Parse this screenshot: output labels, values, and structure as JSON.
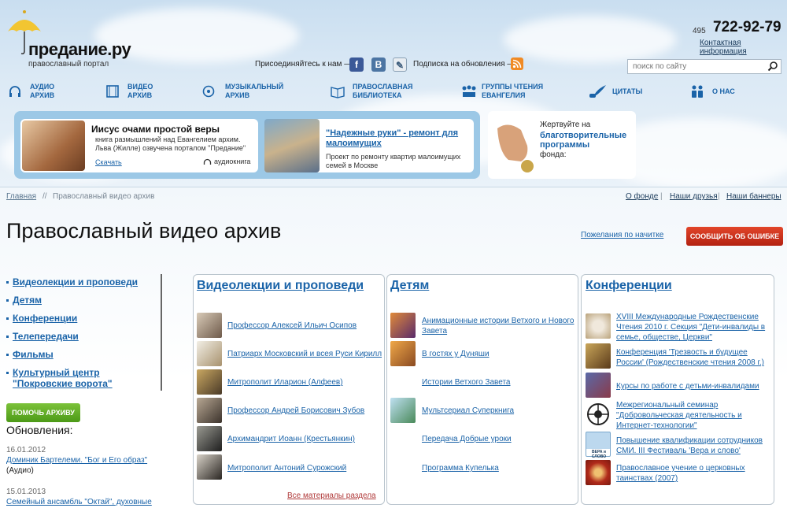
{
  "header": {
    "logo_text": "преданиe.ру",
    "logo_sub": "православный портал",
    "phone_code": "495",
    "phone_number": "722-92-79",
    "contact_link": "Контактная информация",
    "join_label": "Присоединяйтесь к нам —",
    "subscribe_label": "Подписка на обновления —",
    "search_placeholder": "поиск по сайту"
  },
  "nav": [
    {
      "line1": "Аудио",
      "line2": "архив"
    },
    {
      "line1": "Видео",
      "line2": "архив"
    },
    {
      "line1": "Музыкальный",
      "line2": "архив"
    },
    {
      "line1": "Православная",
      "line2": "библиотека"
    },
    {
      "line1": "Группы чтения",
      "line2": "Евангелия"
    },
    {
      "line1": "Цитаты",
      "line2": ""
    },
    {
      "line1": "О нас",
      "line2": ""
    }
  ],
  "banners": {
    "b1": {
      "title": "Иисус очами простой веры",
      "text": "книга размышлений над Евангелием архим. Льва (Жилле) озвучена порталом \"Предание\"",
      "link": "Скачать",
      "tag": "аудиокнига"
    },
    "b2": {
      "title": "\"Надежные руки\" - ремонт для малоимущих",
      "text": "Проект по ремонту квартир малоимущих семей в Москве"
    },
    "b3": {
      "line1": "Жертвуйте на",
      "highlight": "благотворительные программы",
      "line3": "фонда:"
    }
  },
  "breadcrumb": {
    "home": "Главная",
    "sep": "//",
    "current": "Православный видео архив"
  },
  "top_links": [
    "О фонде",
    "Наши друзья",
    "Наши баннеры"
  ],
  "top_links_sep": "|",
  "page_title": "Православный видео архив",
  "wishes_link": "Пожелания по начитке",
  "report_button": "СООБЩИТЬ ОБ ОШИБКЕ",
  "left_menu": [
    "Видеолекции и проповеди",
    "Детям",
    "Конференции",
    "Телепередачи",
    "Фильмы",
    "Культурный центр",
    "\"Покровские ворота\""
  ],
  "help_button": "ПОМОЧЬ АРХИВУ",
  "updates": {
    "title": "Обновления:",
    "items": [
      {
        "date": "16.01.2012",
        "link": "Доминик Бартелеми. \"Бог и Его образ\"",
        "note": "(Аудио)"
      },
      {
        "date": "15.01.2013",
        "link": "Семейный ансамбль \"Октай\", духовные",
        "note": ""
      }
    ]
  },
  "columns": [
    {
      "title": "Видеолекции и проповеди",
      "items": [
        "Профессор Алексей Ильич Осипов",
        "Патриарх Московский и всея Руси Кирилл",
        "Митрополит Иларион (Алфеев)",
        "Профессор Андрей Борисович Зубов",
        "Архимандрит Иоанн (Крестьянкин)",
        "Митрополит Антоний Сурожский"
      ],
      "all_link": "Все материалы раздела"
    },
    {
      "title": "Детям",
      "items": [
        {
          "l1": "Анимационные истории Ветхого и Нового",
          "l2": "Завета"
        },
        {
          "l1": "В гостях у Дуняши",
          "l2": ""
        },
        {
          "l1": "Истории Ветхого Завета",
          "l2": ""
        },
        {
          "l1": "Мультсериал Суперкнига",
          "l2": ""
        },
        {
          "l1": "Передача Добрые уроки",
          "l2": ""
        },
        {
          "l1": "Программа Купелька",
          "l2": ""
        }
      ]
    },
    {
      "title": "Конференции",
      "items": [
        {
          "l1": "XVIII Международные Рождественские",
          "l2": "Чтения 2010 г. Секция \"Дети-инвалиды в",
          "l3": "семье, обществе, Церкви\""
        },
        {
          "l1": "Конференция 'Трезвость и будущее",
          "l2": "России' (Рождественские чтения 2008 г.)",
          "l3": ""
        },
        {
          "l1": "Курсы по работе с детьми-инвалидами",
          "l2": "",
          "l3": ""
        },
        {
          "l1": "Межрегиональный семинар",
          "l2": "\"Добровольческая деятельность и",
          "l3": "Интернет-технологии\""
        },
        {
          "l1": "Повышение квалификации сотрудников",
          "l2": "СМИ. III Фестиваль 'Вера и слово'",
          "l3": ""
        },
        {
          "l1": "Православное учение о церковных",
          "l2": "таинствах (2007)",
          "l3": ""
        }
      ]
    }
  ],
  "thumb_caption": "ВЕРА и СЛОВО"
}
